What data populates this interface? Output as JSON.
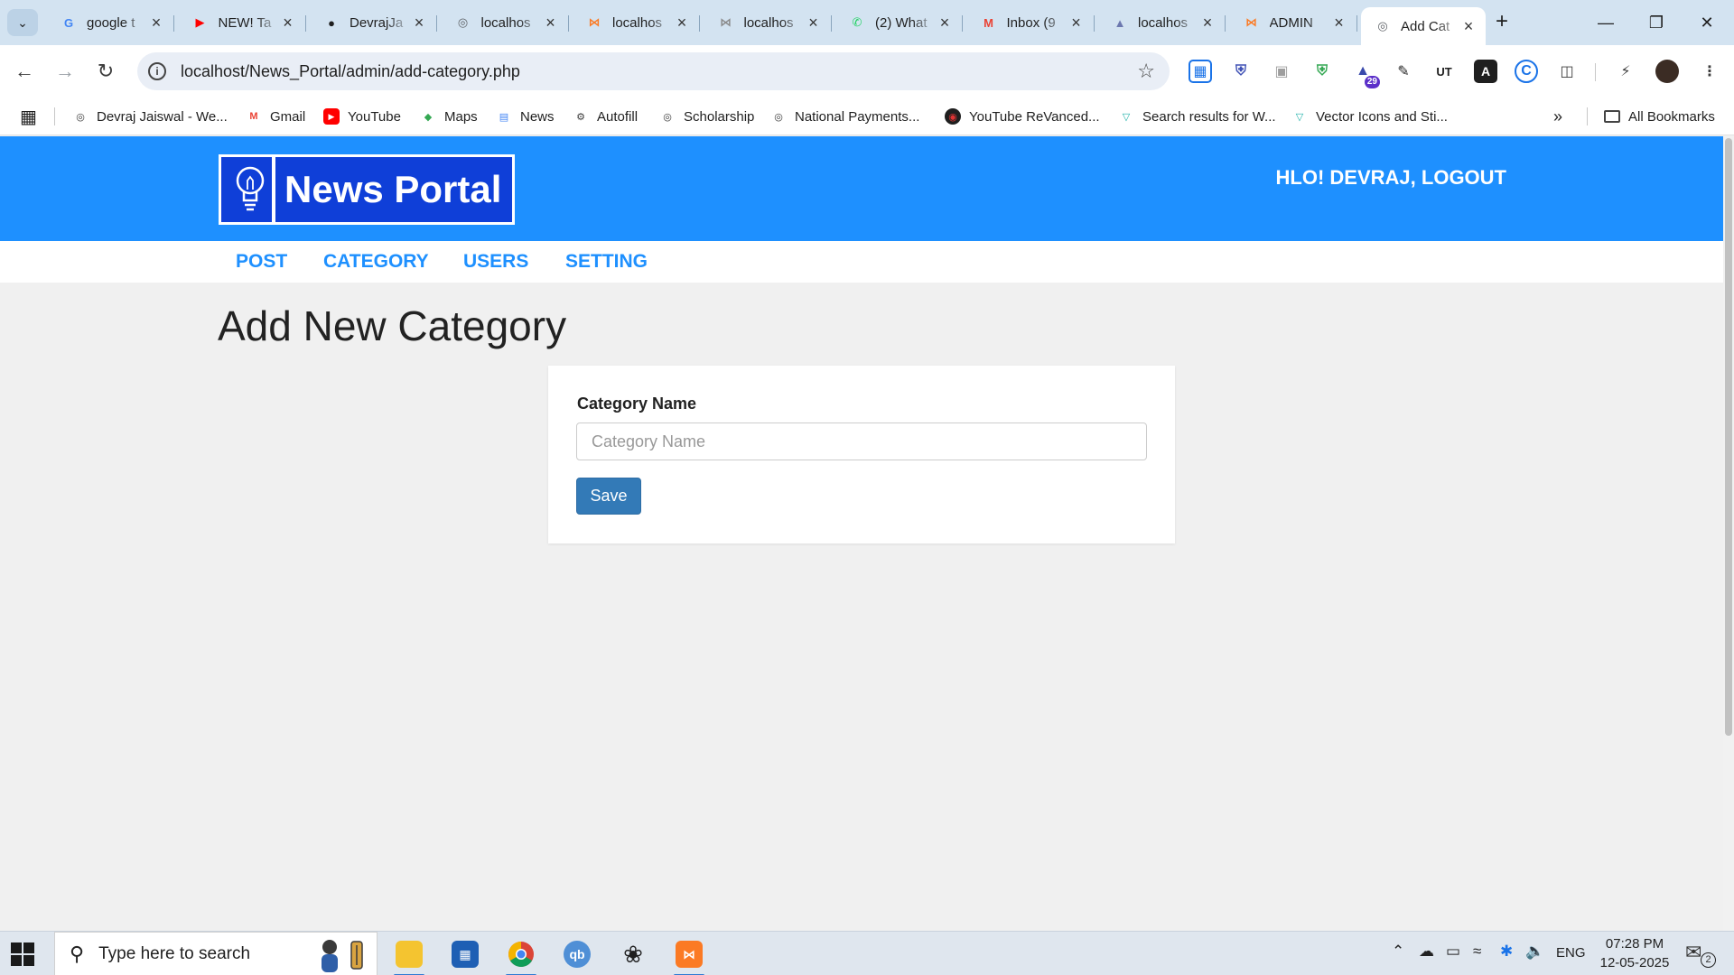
{
  "browser": {
    "tabs": [
      {
        "title": "google t",
        "icon": "google-icon",
        "color": "#4285f4",
        "active": false
      },
      {
        "title": "NEW! Ta",
        "icon": "youtube-icon",
        "color": "#ff0000",
        "active": false
      },
      {
        "title": "DevrajJa",
        "icon": "github-icon",
        "color": "#1f1f1f",
        "active": false
      },
      {
        "title": "localhos",
        "icon": "globe-icon",
        "color": "#5f6368",
        "active": false
      },
      {
        "title": "localhos",
        "icon": "xampp-icon",
        "color": "#fb7a24",
        "active": false
      },
      {
        "title": "localhos",
        "icon": "xampp-icon",
        "color": "#8a8a8a",
        "active": false
      },
      {
        "title": "(2) What",
        "icon": "whatsapp-icon",
        "color": "#25d366",
        "active": false
      },
      {
        "title": "Inbox (9",
        "icon": "gmail-icon",
        "color": "#ea4335",
        "active": false
      },
      {
        "title": "localhos",
        "icon": "phpmyadmin-icon",
        "color": "#6c78af",
        "active": false
      },
      {
        "title": "ADMIN",
        "icon": "xampp-icon",
        "color": "#fb7a24",
        "active": false
      },
      {
        "title": "Add Cat",
        "icon": "globe-icon",
        "color": "#5f6368",
        "active": true
      }
    ],
    "url": "localhost/News_Portal/admin/add-category.php",
    "bookmarks": [
      {
        "label": "Devraj Jaiswal - We...",
        "icon": "globe-icon"
      },
      {
        "label": "Gmail",
        "icon": "gmail-icon"
      },
      {
        "label": "YouTube",
        "icon": "youtube-icon"
      },
      {
        "label": "Maps",
        "icon": "maps-icon"
      },
      {
        "label": "News",
        "icon": "news-icon"
      },
      {
        "label": "Autofill",
        "icon": "gear-icon"
      },
      {
        "label": "Scholarship",
        "icon": "globe-icon"
      },
      {
        "label": "National Payments...",
        "icon": "globe-icon"
      },
      {
        "label": "YouTube ReVanced...",
        "icon": "revanced-icon"
      },
      {
        "label": "Search results for W...",
        "icon": "vector-icon"
      },
      {
        "label": "Vector Icons and Sti...",
        "icon": "vector-icon"
      }
    ],
    "all_bookmarks": "All Bookmarks",
    "extension_badge": "29"
  },
  "site": {
    "logo_text": "News Portal",
    "greeting": "HLO! DEVRAJ, LOGOUT",
    "menu": [
      "POST",
      "CATEGORY",
      "USERS",
      "SETTING"
    ],
    "page_title": "Add New Category",
    "form": {
      "label": "Category Name",
      "placeholder": "Category Name",
      "value": "",
      "submit": "Save"
    },
    "brand_color": "#1e90ff",
    "button_color": "#337ab7"
  },
  "taskbar": {
    "search_placeholder": "Type here to search",
    "language": "ENG",
    "time": "07:28 PM",
    "date": "12-05-2025",
    "notification_count": "2"
  }
}
